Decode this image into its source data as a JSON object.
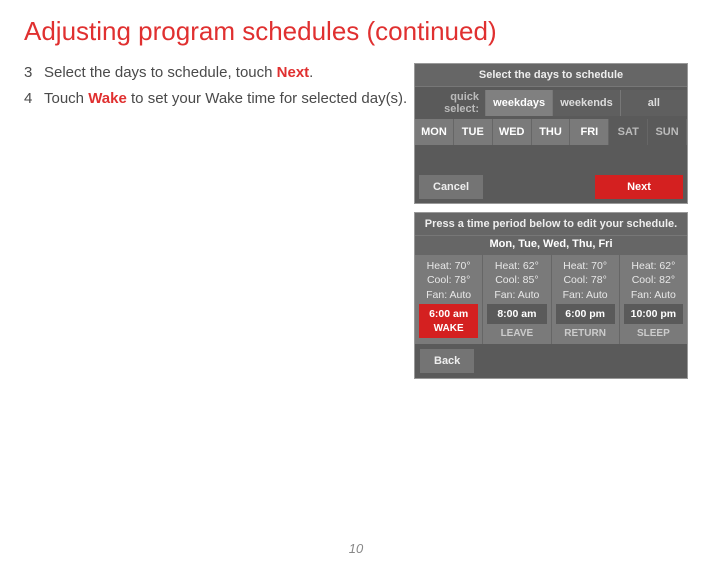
{
  "title": "Adjusting program schedules (continued)",
  "steps": {
    "s3_num": "3",
    "s3_a": "Select the days to schedule, touch ",
    "s3_b": "Next",
    "s3_c": ".",
    "s4_num": "4",
    "s4_a": "Touch ",
    "s4_b": "Wake",
    "s4_c": " to set your Wake time for selected day(s)."
  },
  "screen1": {
    "title": "Select the days to schedule",
    "quick_label": "quick select:",
    "quick": [
      "weekdays",
      "weekends",
      "all"
    ],
    "days": [
      "MON",
      "TUE",
      "WED",
      "THU",
      "FRI",
      "SAT",
      "SUN"
    ],
    "cancel": "Cancel",
    "next": "Next"
  },
  "screen2": {
    "title": "Press a time period below to edit your schedule.",
    "sub": "Mon, Tue, Wed, Thu, Fri",
    "periods": [
      {
        "heat": "Heat: 70°",
        "cool": "Cool: 78°",
        "fan": "Fan: Auto",
        "time": "6:00 am",
        "label": "WAKE"
      },
      {
        "heat": "Heat: 62°",
        "cool": "Cool: 85°",
        "fan": "Fan: Auto",
        "time": "8:00 am",
        "label": "LEAVE"
      },
      {
        "heat": "Heat: 70°",
        "cool": "Cool: 78°",
        "fan": "Fan: Auto",
        "time": "6:00 pm",
        "label": "RETURN"
      },
      {
        "heat": "Heat: 62°",
        "cool": "Cool: 82°",
        "fan": "Fan: Auto",
        "time": "10:00 pm",
        "label": "SLEEP"
      }
    ],
    "back": "Back"
  },
  "page_number": "10"
}
